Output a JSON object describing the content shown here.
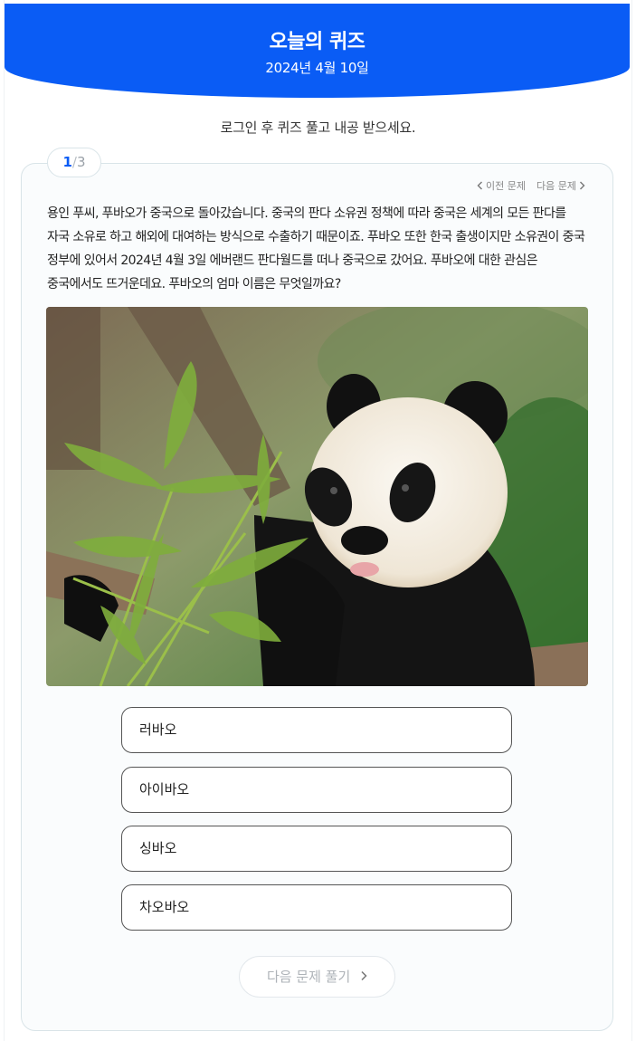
{
  "header": {
    "title": "오늘의 퀴즈",
    "date": "2024년 4월 10일"
  },
  "login_notice": "로그인 후 퀴즈 풀고 내공 받으세요.",
  "pagination": {
    "current": "1",
    "separator": "/",
    "total": "3"
  },
  "question_nav": {
    "prev": "이전 문제",
    "next": "다음 문제"
  },
  "question": {
    "text": "용인 푸씨, 푸바오가 중국으로 돌아갔습니다. 중국의 판다 소유권 정책에 따라 중국은 세계의 모든 판다를 자국 소유로 하고 해외에 대여하는 방식으로 수출하기 때문이죠. 푸바오 또한 한국 출생이지만 소유권이 중국 정부에 있어서 2024년 4월 3일 에버랜드 판다월드를 떠나 중국으로 갔어요. 푸바오에 대한 관심은 중국에서도 뜨거운데요. 푸바오의 엄마 이름은 무엇일까요?"
  },
  "options": [
    {
      "label": "러바오"
    },
    {
      "label": "아이바오"
    },
    {
      "label": "싱바오"
    },
    {
      "label": "차오바오"
    }
  ],
  "next_button": {
    "label": "다음 문제 풀기",
    "icon": "chevron-right-icon"
  },
  "colors": {
    "brand": "#0a5cf5",
    "border": "#d9e4e8"
  }
}
